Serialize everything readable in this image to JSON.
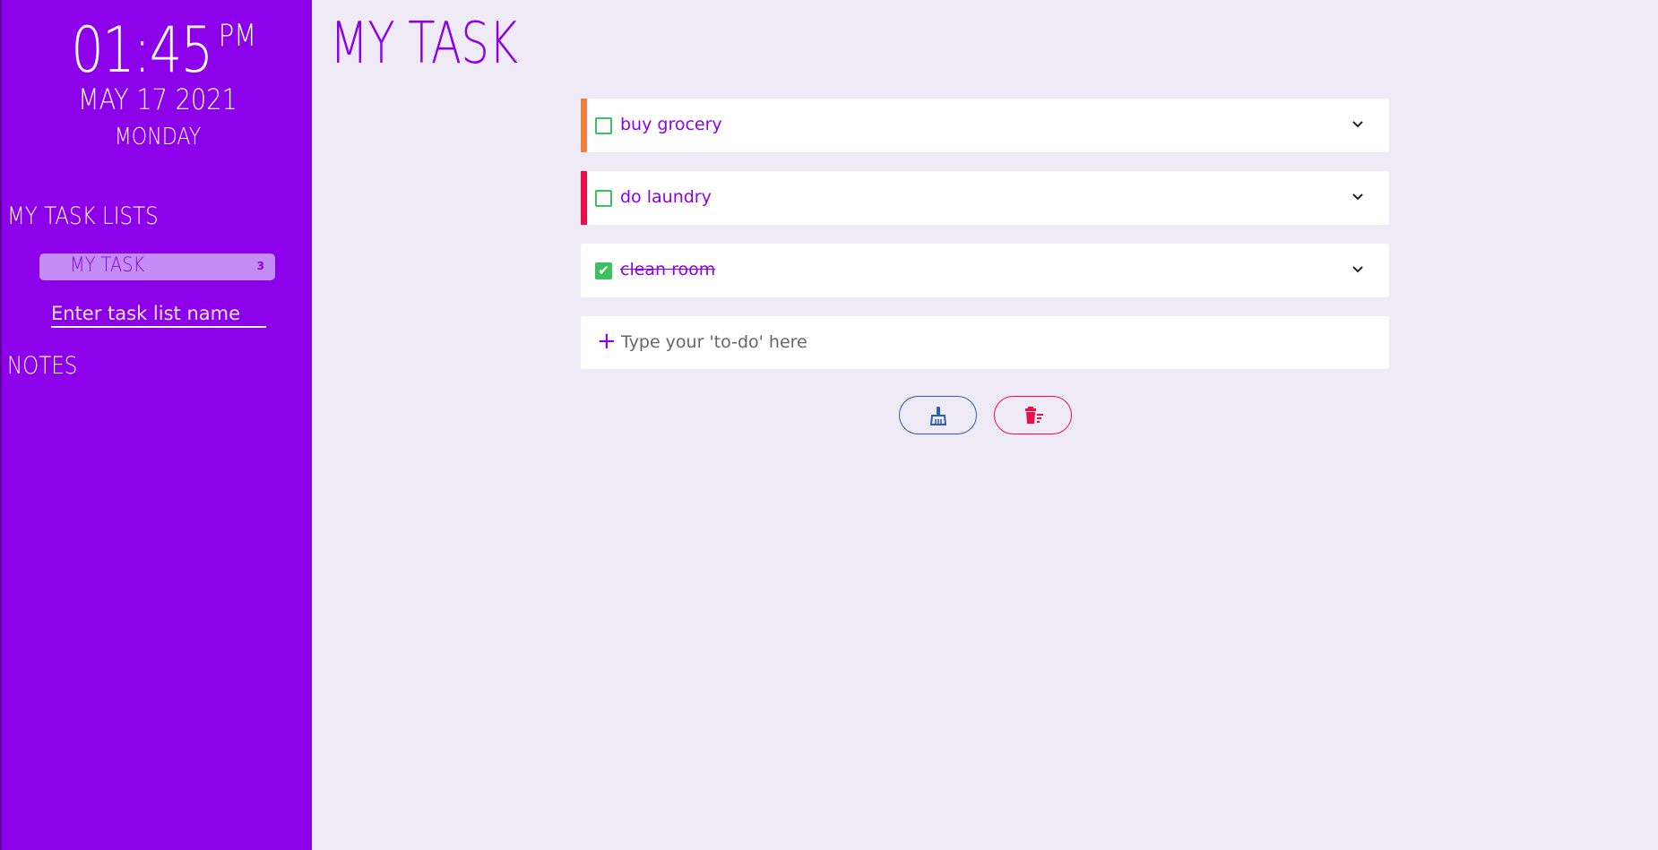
{
  "sidebar": {
    "clock": {
      "time": "01:45",
      "ampm": "PM"
    },
    "date": "MAY 17 2021",
    "weekday": "MONDAY",
    "task_lists_title": "MY TASK LISTS",
    "task_lists": [
      {
        "name": "MY TASK",
        "count": "3"
      }
    ],
    "new_list_placeholder": "Enter task list name",
    "notes_title": "NOTES"
  },
  "main": {
    "title": "MY TASK",
    "tasks": [
      {
        "label": "buy grocery",
        "done": false,
        "accent": "#f08040"
      },
      {
        "label": "do laundry",
        "done": false,
        "accent": "#e8104a"
      },
      {
        "label": "clean room",
        "done": true,
        "accent": ""
      }
    ],
    "add_placeholder": "Type your 'to-do' here",
    "add_icon": "plus-icon",
    "actions": [
      {
        "icon": "broom-icon",
        "color": "#2f5db0"
      },
      {
        "icon": "trash-list-icon",
        "color": "#e8104a"
      }
    ]
  },
  "colors": {
    "primary": "#8c00ea",
    "background": "#eeebf7",
    "check_green": "#3cc060"
  }
}
